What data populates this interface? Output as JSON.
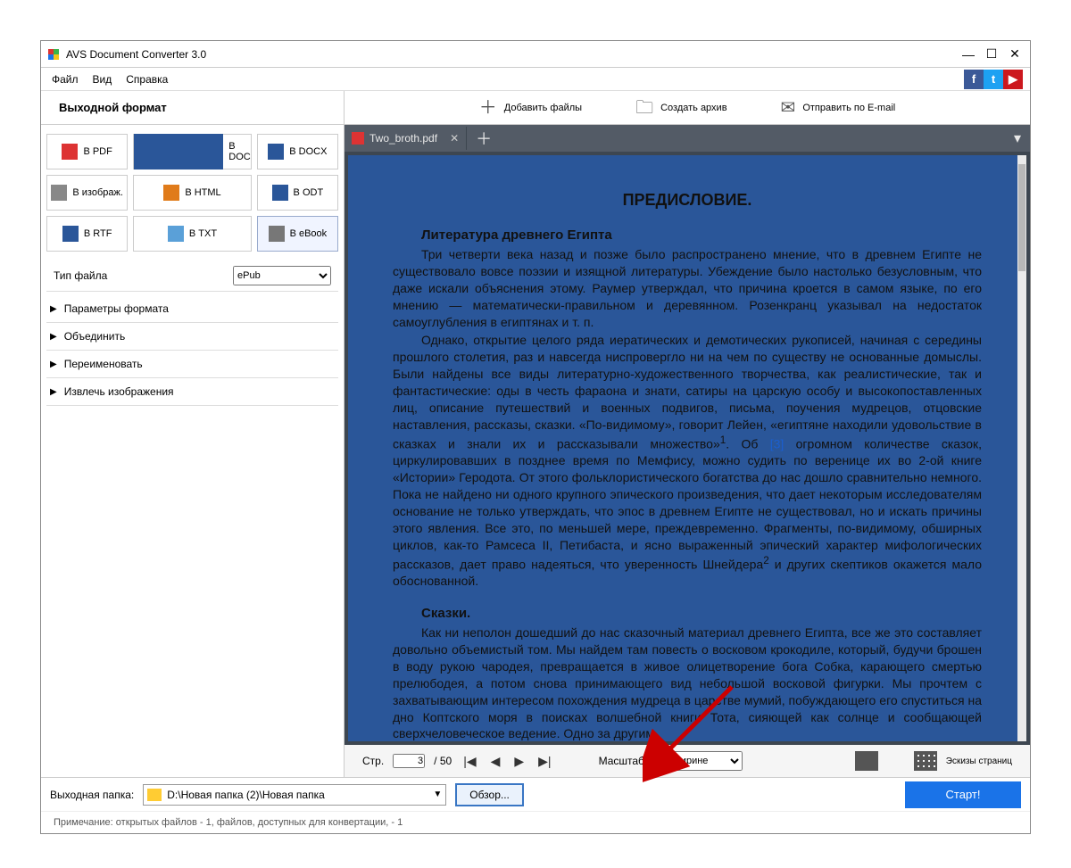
{
  "app": {
    "title": "AVS Document Converter 3.0"
  },
  "menu": {
    "file": "Файл",
    "view": "Вид",
    "help": "Справка"
  },
  "sidebar": {
    "header": "Выходной формат",
    "formats": {
      "pdf": "В PDF",
      "doc": "В DOC",
      "docx": "В DOCX",
      "img": "В изображ.",
      "html": "В HTML",
      "odt": "В ODT",
      "rtf": "В RTF",
      "txt": "В TXT",
      "ebook": "В eBook"
    },
    "filetype_label": "Тип файла",
    "filetype_value": "ePub",
    "acc": {
      "params": "Параметры формата",
      "merge": "Объединить",
      "rename": "Переименовать",
      "extract": "Извлечь изображения"
    }
  },
  "topactions": {
    "add": "Добавить файлы",
    "archive": "Создать архив",
    "email": "Отправить по E-mail"
  },
  "tab": {
    "name": "Two_broth.pdf"
  },
  "document": {
    "title": "ПРЕДИСЛОВИЕ.",
    "h1": "Литература древнего Египта",
    "p1": "Три четверти века назад и позже было распространено мнение, что в древнем Египте не существовало вовсе поэзии и изящной литературы. Убеждение было настолько безусловным, что даже искали объяснения этому. Раумер утверждал, что причина кроется в самом языке, по его мнению — математически-правильном и деревянном. Розенкранц указывал на недостаток самоуглубления в египтянах и т. п.",
    "p2a": "Однако, открытие целого ряда иератических и демотических рукописей, начиная с середины прошлого столетия, раз и навсегда ниспровергло ни на чем по существу не основанные домыслы. Были найдены все виды литературно-художественного творчества, как реалистические, так и фантастические: оды в честь фараона и знати, сатиры на царскую особу и высокопоставленных лиц, описание путешествий и военных подвигов, письма, поучения мудрецов, отцовские наставления, рассказы, сказки. «По-видимому», говорит Лейен, «египтяне находили удовольствие в сказках и знали их и рассказывали множество»",
    "p2b": ". Об ",
    "p2ref": "[3]",
    "p2c": " огромном количестве сказок, циркулировавших в позднее время по Мемфису, можно судить по веренице их во 2-ой книге «Истории» Геродота. От этого фольклористического богатства до нас дошло сравнительно немного. Пока не найдено ни одного крупного эпического произведения, что дает некоторым исследователям основание не только утверждать, что эпос в древнем Египте не существовал, но и искать причины этого явления. Все это, по меньшей мере, преждевременно. Фрагменты, по-видимому, обширных циклов, как-то Рамсеса II, Петибаста, и ясно выраженный эпический характер мифологических рассказов, дает право надеяться, что уверенность Шнейдера",
    "p2d": " и других скептиков окажется мало обоснованной.",
    "h2": "Сказки.",
    "p3": "Как ни неполон дошедший до нас сказочный материал древнего Египта, все же это составляет довольно объемистый том. Мы найдем там повесть о восковом крокодиле, который, будучи брошен в воду рукою чародея, превращается в живое олицетворение бога Собка, карающего смертью прелюбодея, а потом снова принимающего вид небольшой восковой фигурки. Мы прочтем с захватывающим интересом похождения мудреца в царстве мумий, побуждающего его спуститься на дно Коптского моря в поисках волшебной книги Тота, сияющей как солнце и сообщающей сверхчеловеческое ведение. Одно за другим"
  },
  "previewbar": {
    "page_label": "Стр.",
    "page_current": "3",
    "page_total": "/ 50",
    "zoom_label": "Масштаб",
    "zoom_value": "По ширине",
    "thumbs": "Эскизы страниц"
  },
  "bottom": {
    "folder_label": "Выходная папка:",
    "folder_path": "D:\\Новая папка (2)\\Новая папка",
    "browse": "Обзор...",
    "start": "Старт!",
    "note": "Примечание: открытых файлов - 1, файлов, доступных для конвертации, - 1"
  }
}
